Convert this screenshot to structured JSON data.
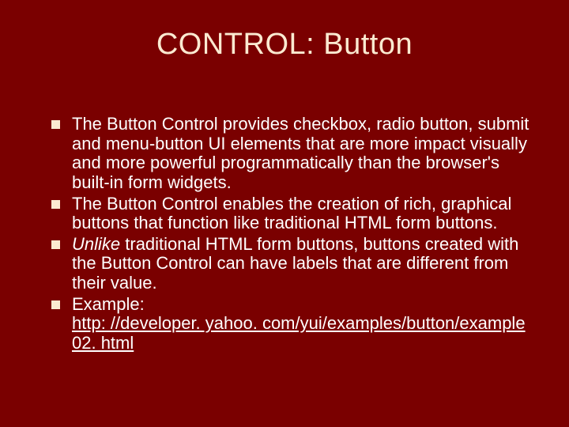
{
  "title": "CONTROL: Button",
  "bullets": {
    "b1": "The Button Control provides checkbox, radio button, submit and menu-button UI elements that are more impact visually and more powerful programmatically than the browser's built-in form widgets.",
    "b2": "The Button Control enables the creation of rich, graphical buttons that function like traditional HTML form buttons.",
    "b3_italic": "Unlike",
    "b3_rest": " traditional HTML form buttons, buttons created with the Button Control can have labels that are different from their value.",
    "b4_label": "Example:",
    "b4_link": "http: //developer. yahoo. com/yui/examples/button/example 02. html"
  }
}
